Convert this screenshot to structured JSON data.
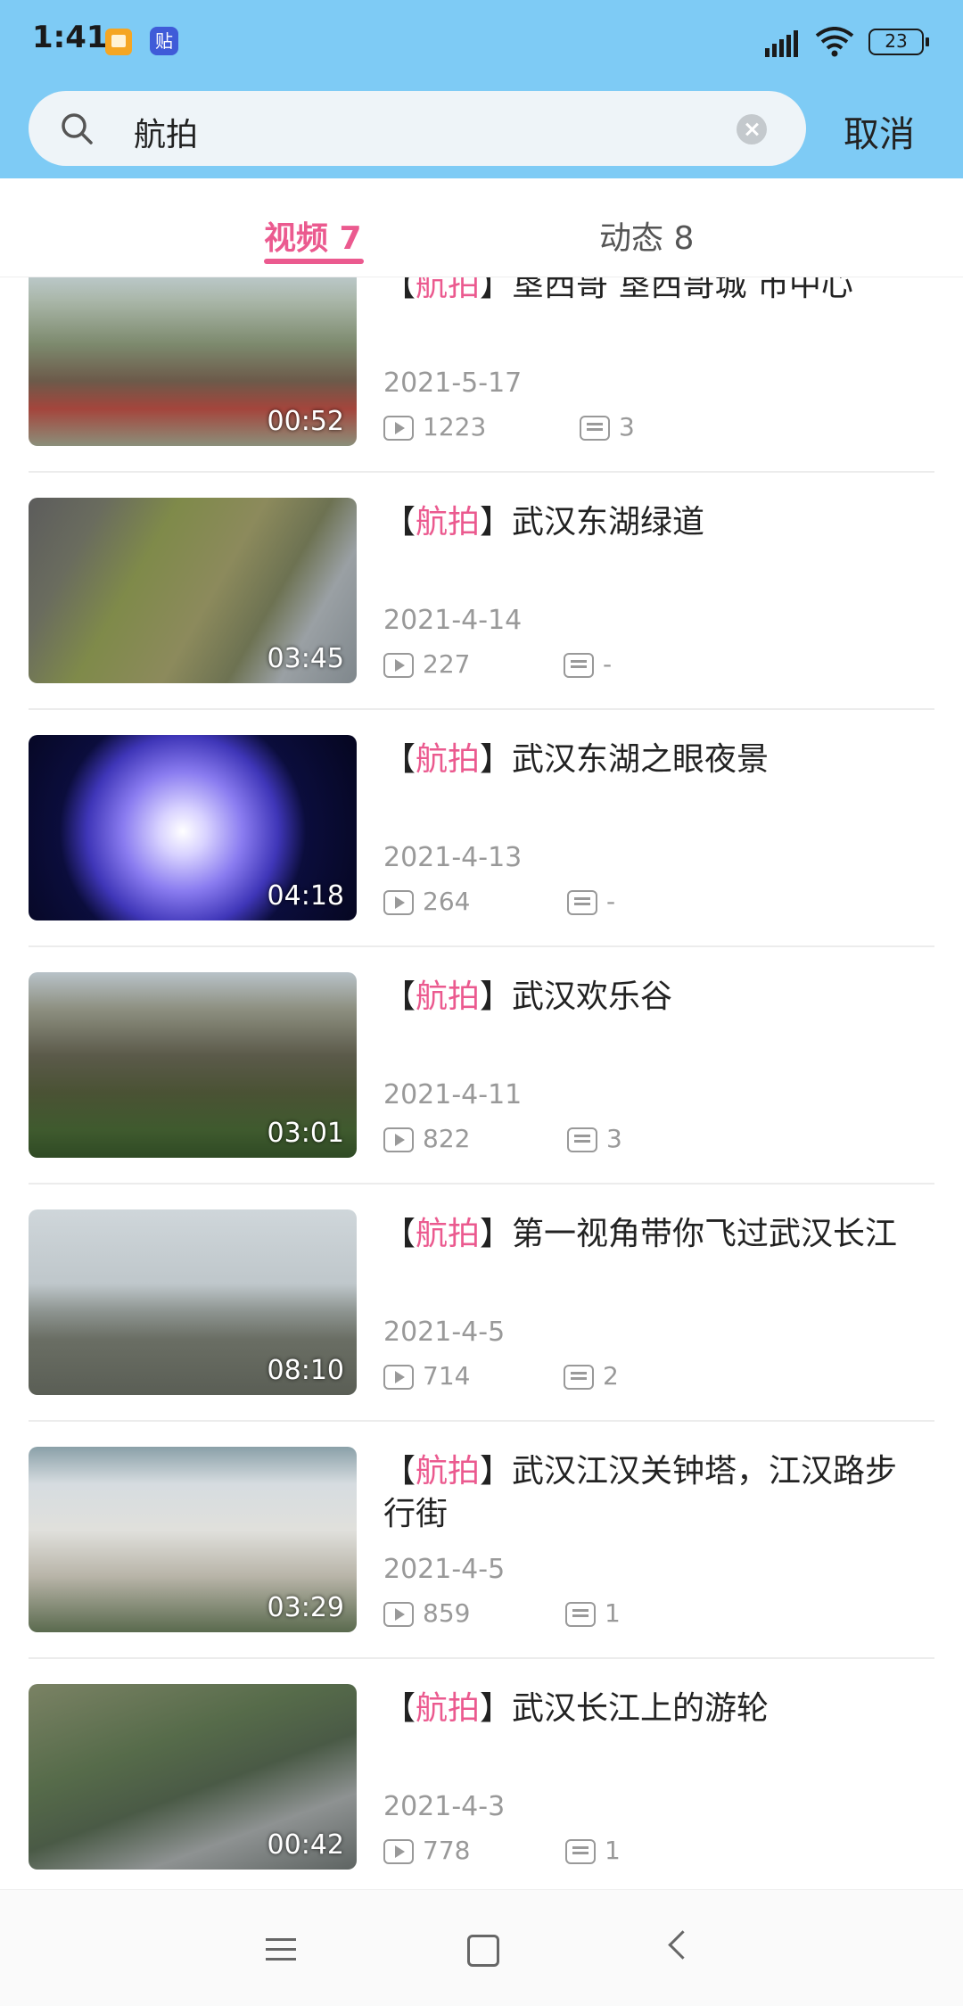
{
  "status_bar": {
    "time": "1:41",
    "tieba_glyph": "贴",
    "battery": "23",
    "icons": [
      "book-notification-icon",
      "tieba-notification-icon",
      "signal-icon",
      "wifi-icon",
      "battery-icon"
    ]
  },
  "search": {
    "query": "航拍",
    "cancel_label": "取消",
    "icons": [
      "search-icon",
      "clear-icon"
    ]
  },
  "tabs": [
    {
      "label": "视频 7",
      "active": true
    },
    {
      "label": "动态 8",
      "active": false
    }
  ],
  "results": [
    {
      "bracket_open": "【",
      "keyword": "航拍",
      "bracket_close": "】",
      "title": "垦西哥 垦西哥城 市中心",
      "date": "2021-5-17",
      "views": "1223",
      "comments": "3",
      "duration": "00:52"
    },
    {
      "bracket_open": "【",
      "keyword": "航拍",
      "bracket_close": "】",
      "title": "武汉东湖绿道",
      "date": "2021-4-14",
      "views": "227",
      "comments": "-",
      "duration": "03:45"
    },
    {
      "bracket_open": "【",
      "keyword": "航拍",
      "bracket_close": "】",
      "title": "武汉东湖之眼夜景",
      "date": "2021-4-13",
      "views": "264",
      "comments": "-",
      "duration": "04:18"
    },
    {
      "bracket_open": "【",
      "keyword": "航拍",
      "bracket_close": "】",
      "title": "武汉欢乐谷",
      "date": "2021-4-11",
      "views": "822",
      "comments": "3",
      "duration": "03:01"
    },
    {
      "bracket_open": "【",
      "keyword": "航拍",
      "bracket_close": "】",
      "title": "第一视角带你飞过武汉长江",
      "date": "2021-4-5",
      "views": "714",
      "comments": "2",
      "duration": "08:10"
    },
    {
      "bracket_open": "【",
      "keyword": "航拍",
      "bracket_close": "】",
      "title": "武汉江汉关钟塔，江汉路步行街",
      "date": "2021-4-5",
      "views": "859",
      "comments": "1",
      "duration": "03:29"
    },
    {
      "bracket_open": "【",
      "keyword": "航拍",
      "bracket_close": "】",
      "title": "武汉长江上的游轮",
      "date": "2021-4-3",
      "views": "778",
      "comments": "1",
      "duration": "00:42"
    }
  ],
  "nav_bar": {
    "icons": [
      "menu-icon",
      "home-icon",
      "back-icon"
    ]
  },
  "colors": {
    "header_bg": "#7ecbf5",
    "accent": "#eb5a8f",
    "meta_text": "#999999"
  }
}
